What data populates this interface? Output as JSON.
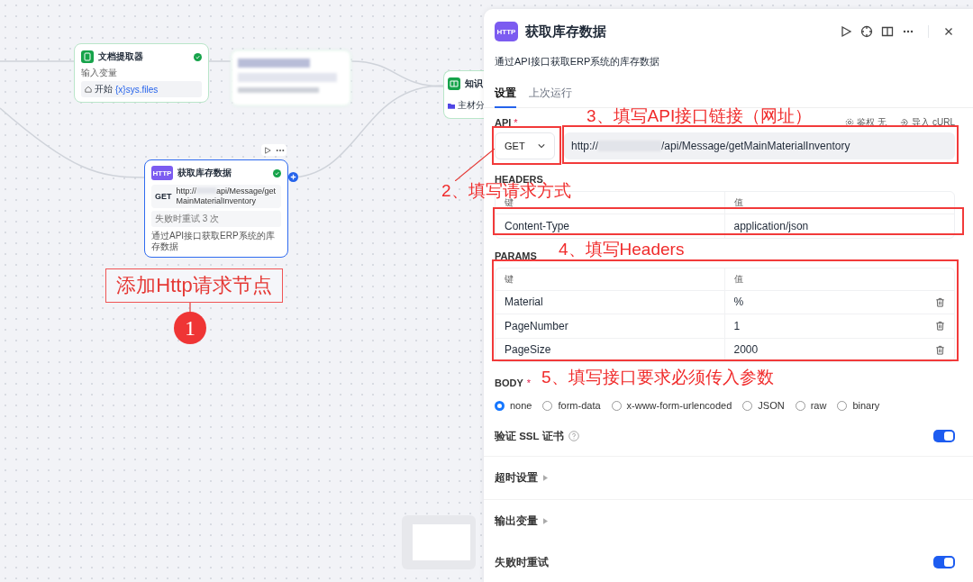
{
  "canvas": {
    "doc_node": {
      "title": "文档提取器",
      "input_label": "输入变量",
      "source": "开始",
      "var_icon": "{x}",
      "variable": "sys.files",
      "succeeded": true
    },
    "knowledge_node": {
      "title": "知识",
      "item": "主材分"
    },
    "http_node": {
      "badge": "HTTP",
      "title": "获取库存数据",
      "succeeded": true,
      "method": "GET",
      "url_start": "http://",
      "url_end": "api/Message/getMainMaterialInventory",
      "retry": "失败时重试 3 次",
      "description": "通过API接口获取ERP系统的库存数据",
      "selected": true
    }
  },
  "annotations": [
    {
      "kind": "box",
      "text": "添加Http请求节点"
    },
    {
      "kind": "step",
      "text": "1"
    },
    {
      "kind": "note",
      "text": "2、填写请求方式"
    },
    {
      "kind": "note",
      "text": "3、填写API接口链接（网址）"
    },
    {
      "kind": "note",
      "text": "4、填写Headers"
    },
    {
      "kind": "note",
      "text": "5、填写接口要求必须传入参数"
    }
  ],
  "panel": {
    "badge": "HTTP",
    "title": "获取库存数据",
    "description": "通过API接口获取ERP系统的库存数据",
    "tabs": [
      {
        "label": "设置",
        "selected": true
      },
      {
        "label": "上次运行",
        "selected": false
      }
    ],
    "api": {
      "label": "API",
      "required_mark": "*",
      "auth": "鉴权 无",
      "import": "导入 cURL",
      "method": "GET",
      "url_start": "http://",
      "url_end": "/api/Message/getMainMaterialInventory"
    },
    "headers": {
      "label": "HEADERS",
      "columns": [
        "键",
        "值"
      ],
      "rows": [
        {
          "key": "Content-Type",
          "value": "application/json"
        }
      ]
    },
    "params": {
      "label": "PARAMS",
      "columns": [
        "键",
        "值"
      ],
      "rows": [
        {
          "key": "Material",
          "value": "%",
          "deletable": true
        },
        {
          "key": "PageNumber",
          "value": "1",
          "deletable": true
        },
        {
          "key": "PageSize",
          "value": "2000",
          "deletable": true
        }
      ]
    },
    "body": {
      "label": "BODY",
      "required_mark": "*",
      "options": [
        {
          "label": "none",
          "selected": true
        },
        {
          "label": "form-data",
          "selected": false
        },
        {
          "label": "x-www-form-urlencoded",
          "selected": false
        },
        {
          "label": "JSON",
          "selected": false
        },
        {
          "label": "raw",
          "selected": false
        },
        {
          "label": "binary",
          "selected": false
        }
      ]
    },
    "ssl": {
      "label": "验证 SSL 证书",
      "on": true
    },
    "sections": [
      "超时设置",
      "输出变量"
    ],
    "retry": {
      "label": "失败时重试",
      "on": true
    }
  }
}
